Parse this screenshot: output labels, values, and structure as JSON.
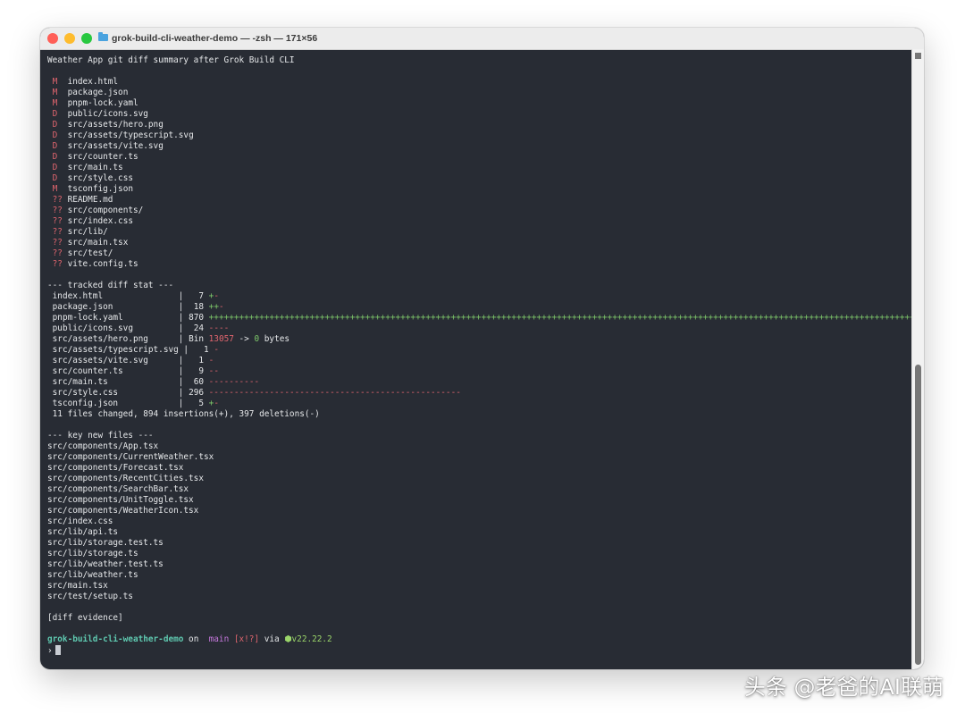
{
  "window": {
    "title": "grok-build-cli-weather-demo — -zsh — 171×56"
  },
  "terminal": {
    "header": "Weather App git diff summary after Grok Build CLI",
    "status_files": [
      {
        "code": "M",
        "path": "index.html"
      },
      {
        "code": "M",
        "path": "package.json"
      },
      {
        "code": "M",
        "path": "pnpm-lock.yaml"
      },
      {
        "code": "D",
        "path": "public/icons.svg"
      },
      {
        "code": "D",
        "path": "src/assets/hero.png"
      },
      {
        "code": "D",
        "path": "src/assets/typescript.svg"
      },
      {
        "code": "D",
        "path": "src/assets/vite.svg"
      },
      {
        "code": "D",
        "path": "src/counter.ts"
      },
      {
        "code": "D",
        "path": "src/main.ts"
      },
      {
        "code": "D",
        "path": "src/style.css"
      },
      {
        "code": "M",
        "path": "tsconfig.json"
      },
      {
        "code": "??",
        "path": "README.md"
      },
      {
        "code": "??",
        "path": "src/components/"
      },
      {
        "code": "??",
        "path": "src/index.css"
      },
      {
        "code": "??",
        "path": "src/lib/"
      },
      {
        "code": "??",
        "path": "src/main.tsx"
      },
      {
        "code": "??",
        "path": "src/test/"
      },
      {
        "code": "??",
        "path": "vite.config.ts"
      }
    ],
    "diff_stat_header": "--- tracked diff stat ---",
    "diff_stat": [
      {
        "file": "index.html",
        "count": "7",
        "plus": 1,
        "minus": 1
      },
      {
        "file": "package.json",
        "count": "18",
        "plus": 2,
        "minus": 1
      },
      {
        "file": "pnpm-lock.yaml",
        "count": "870",
        "plus": 147,
        "minus": 0
      },
      {
        "file": "public/icons.svg",
        "count": "24",
        "plus": 0,
        "minus": 4
      },
      {
        "file": "src/assets/hero.png",
        "count": "Bin",
        "bin_from": "13057",
        "bin_to": "0",
        "bin_unit": "bytes"
      },
      {
        "file": "src/assets/typescript.svg",
        "count": "1",
        "plus": 0,
        "minus": 1
      },
      {
        "file": "src/assets/vite.svg",
        "count": "1",
        "plus": 0,
        "minus": 1
      },
      {
        "file": "src/counter.ts",
        "count": "9",
        "plus": 0,
        "minus": 2
      },
      {
        "file": "src/main.ts",
        "count": "60",
        "plus": 0,
        "minus": 10
      },
      {
        "file": "src/style.css",
        "count": "296",
        "plus": 0,
        "minus": 50
      },
      {
        "file": "tsconfig.json",
        "count": "5",
        "plus": 1,
        "minus": 1
      }
    ],
    "diff_summary": "11 files changed, 894 insertions(+), 397 deletions(-)",
    "new_files_header": "--- key new files ---",
    "new_files": [
      "src/components/App.tsx",
      "src/components/CurrentWeather.tsx",
      "src/components/Forecast.tsx",
      "src/components/RecentCities.tsx",
      "src/components/SearchBar.tsx",
      "src/components/UnitToggle.tsx",
      "src/components/WeatherIcon.tsx",
      "src/index.css",
      "src/lib/api.ts",
      "src/lib/storage.test.ts",
      "src/lib/storage.ts",
      "src/lib/weather.test.ts",
      "src/lib/weather.ts",
      "src/main.tsx",
      "src/test/setup.ts"
    ],
    "evidence": "[diff evidence]",
    "prompt": {
      "dir": "grok-build-cli-weather-demo",
      "on": " on ",
      "branch_icon": "",
      "branch": "main",
      "flags": "[x!?]",
      "via": " via ",
      "node_icon": "⬢",
      "node_version": "v22.22.2",
      "symbol": "›"
    }
  },
  "watermark": "头条 @老爸的AI联萌",
  "colors": {
    "terminal_bg": "#282c34",
    "status_code": "#e0656e",
    "insertion": "#7ec86a",
    "deletion": "#e0656e",
    "prompt_dir": "#5fc9b0",
    "branch": "#c678dd",
    "node": "#9bd66a"
  }
}
